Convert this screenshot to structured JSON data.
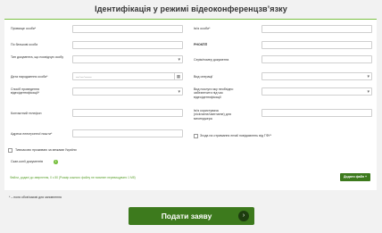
{
  "page": {
    "title": "Ідентифікація у режимі відеоконференцзв’язку"
  },
  "form": {
    "left": [
      {
        "label": "Прізвище особи*",
        "type": "text"
      },
      {
        "label": "По батькові особи",
        "type": "text"
      },
      {
        "label": "Тип документа, що посвідчує особу",
        "type": "select"
      },
      {
        "label": "Дата народження особи*",
        "type": "date",
        "value": "__.__.____"
      },
      {
        "label": "Спосіб проведення відеоідентифікації*",
        "type": "select"
      },
      {
        "label": "Контактний телефон",
        "type": "text"
      },
      {
        "label": "Адреса електронної пошти*",
        "type": "text"
      }
    ],
    "right": [
      {
        "label": "Ім’я особи*",
        "type": "text"
      },
      {
        "label": "РНОКПП",
        "type": "text"
      },
      {
        "label": "Серія/номер документа",
        "type": "text"
      },
      {
        "label": "Вид операції",
        "type": "select"
      },
      {
        "label": "Вид послуги яку необхідно забезпечити під час відеоідентифікації",
        "type": "select"
      },
      {
        "label": "Ім’я користувача (nickname/username) для месенджера",
        "type": "text"
      }
    ],
    "consent_label": "Згода на отримання email повідомлень від ГФУ*",
    "residency_label": "Тимчасово проживаю за межами України",
    "scans_label": "Скан-копії документів",
    "scans_info_icon": "info-icon",
    "files_note": "Файли, додані до звернення, 0 з 50 (Розмір кожного файлу не повинен перевищувати 1 Мб)",
    "add_files_label": "Додати файл +"
  },
  "footer": {
    "required_note": "* – поля обов’язкові для заповнення",
    "submit_label": "Подати заяву",
    "submit_icon": "chevron-right-icon"
  },
  "colors": {
    "accent_green": "#3d7a1d",
    "light_green": "#7ac142",
    "background": "#f2f2f2"
  }
}
